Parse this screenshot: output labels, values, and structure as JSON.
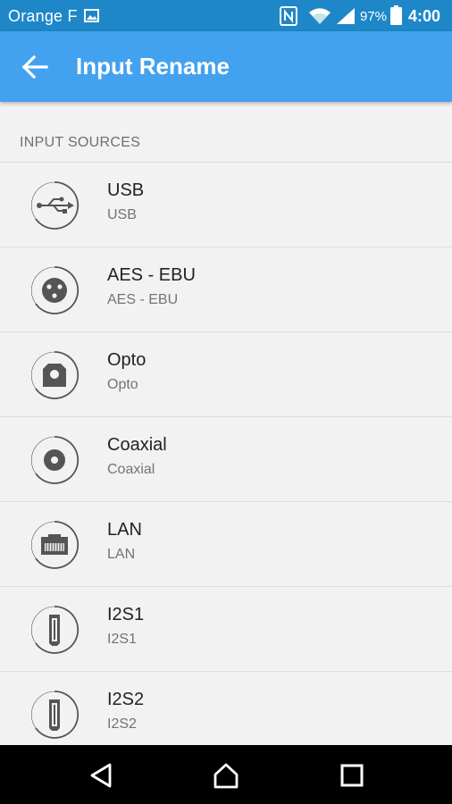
{
  "status_bar": {
    "carrier": "Orange F",
    "battery_percent": "97%",
    "time": "4:00",
    "icons": [
      "image-icon",
      "nfc-icon",
      "wifi-icon",
      "signal-icon",
      "battery-icon"
    ]
  },
  "app_bar": {
    "title": "Input Rename",
    "back_icon": "arrow-left-icon",
    "color": "#43a2ef"
  },
  "section": {
    "header": "INPUT SOURCES"
  },
  "inputs": [
    {
      "name": "USB",
      "subtitle": "USB",
      "icon": "usb-icon"
    },
    {
      "name": "AES - EBU",
      "subtitle": "AES - EBU",
      "icon": "xlr-icon"
    },
    {
      "name": "Opto",
      "subtitle": "Opto",
      "icon": "optical-icon"
    },
    {
      "name": "Coaxial",
      "subtitle": "Coaxial",
      "icon": "coaxial-icon"
    },
    {
      "name": "LAN",
      "subtitle": "LAN",
      "icon": "ethernet-icon"
    },
    {
      "name": "I2S1",
      "subtitle": "I2S1",
      "icon": "hdmi-icon"
    },
    {
      "name": "I2S2",
      "subtitle": "I2S2",
      "icon": "hdmi-icon"
    }
  ],
  "nav_bar": {
    "buttons": [
      "back-triangle-icon",
      "home-icon",
      "recents-icon"
    ]
  }
}
